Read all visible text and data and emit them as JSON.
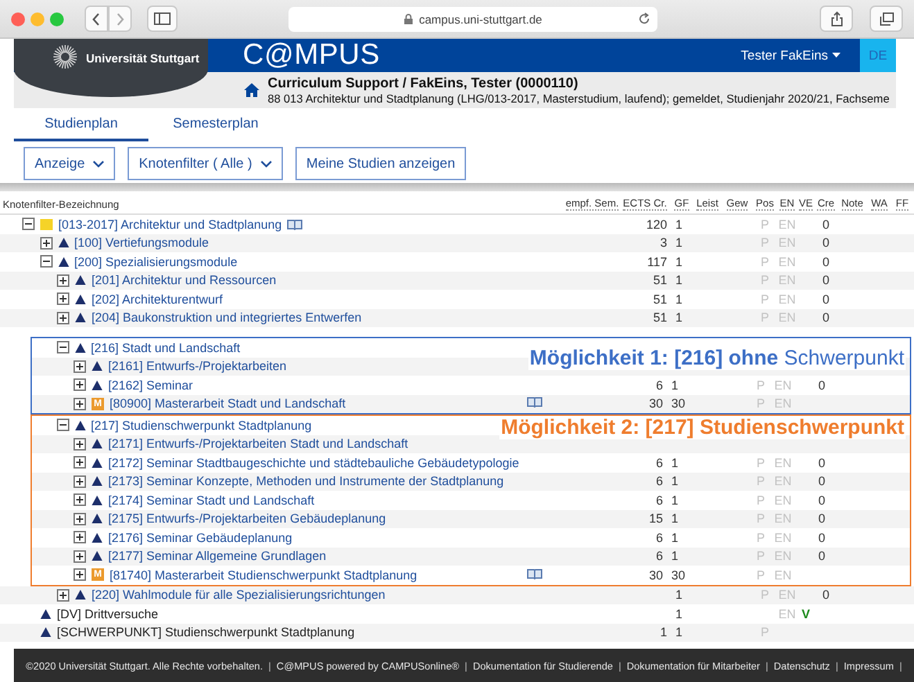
{
  "browser": {
    "url": "campus.uni-stuttgart.de"
  },
  "header": {
    "university": "Universität Stuttgart",
    "brand": "C@MPUS",
    "user": "Tester FakEins",
    "language": "DE"
  },
  "context": {
    "title": "Curriculum Support  / FakEins, Tester (0000110)",
    "subtitle": "88 013 Architektur und Stadtplanung (LHG/013-2017, Masterstudium, laufend); gemeldet, Studienjahr 2020/21, Fachseme"
  },
  "tabs": [
    {
      "label": "Studienplan",
      "selected": true
    },
    {
      "label": "Semesterplan",
      "selected": false
    }
  ],
  "toolbar": [
    {
      "label": "Anzeige",
      "dropdown": true
    },
    {
      "label": "Knotenfilter ( Alle )",
      "dropdown": true
    },
    {
      "label": "Meine Studien anzeigen",
      "dropdown": false
    }
  ],
  "table": {
    "tree_column": "Knotenfilter-Bezeichnung",
    "columns": [
      "empf. Sem.",
      "ECTS Cr.",
      "GF",
      "Leist",
      "Gew",
      "Pos",
      "EN",
      "VE",
      "Cre",
      "Note",
      "WA",
      "FF"
    ],
    "rows": [
      {
        "name": "[013-2017] Architektur und Stadtplanung",
        "kind": "folder",
        "link": true,
        "expanded": true,
        "book": true,
        "cells": [
          null,
          "120",
          "1",
          null,
          null,
          "P",
          "EN",
          null,
          "0",
          null,
          null,
          null
        ],
        "children": [
          {
            "name": "[100] Vertiefungsmodule",
            "kind": "module",
            "link": true,
            "expanded": false,
            "cells": [
              null,
              "3",
              "1",
              null,
              null,
              "P",
              "EN",
              null,
              "0",
              null,
              null,
              null
            ]
          },
          {
            "name": "[200] Spezialisierungsmodule",
            "kind": "module",
            "link": true,
            "expanded": true,
            "cells": [
              null,
              "117",
              "1",
              null,
              null,
              "P",
              "EN",
              null,
              "0",
              null,
              null,
              null
            ],
            "children": [
              {
                "name": "[201] Architektur und Ressourcen",
                "kind": "module",
                "link": true,
                "expanded": false,
                "cells": [
                  null,
                  "51",
                  "1",
                  null,
                  null,
                  "P",
                  "EN",
                  null,
                  "0",
                  null,
                  null,
                  null
                ]
              },
              {
                "name": "[202] Architekturentwurf",
                "kind": "module",
                "link": true,
                "expanded": false,
                "cells": [
                  null,
                  "51",
                  "1",
                  null,
                  null,
                  "P",
                  "EN",
                  null,
                  "0",
                  null,
                  null,
                  null
                ]
              },
              {
                "name": "[204] Baukonstruktion und integriertes Entwerfen",
                "kind": "module",
                "link": true,
                "expanded": false,
                "cells": [
                  null,
                  "51",
                  "1",
                  null,
                  null,
                  "P",
                  "EN",
                  null,
                  "0",
                  null,
                  null,
                  null
                ]
              },
              {
                "name": "[216] Stadt und Landschaft",
                "kind": "module",
                "link": true,
                "expanded": true,
                "annotation": {
                  "text": "**Möglichkeit 1: [216] ohne** Schwerpunkt",
                  "color": "#3d6fc6",
                  "bold": false
                },
                "children": [
                  {
                    "name": "[2161] Entwurfs-/Projektarbeiten",
                    "kind": "module",
                    "link": true,
                    "expanded": false
                  },
                  {
                    "name": "[2162] Seminar",
                    "kind": "module",
                    "link": true,
                    "expanded": false,
                    "cells": [
                      null,
                      "6",
                      "1",
                      null,
                      null,
                      "P",
                      "EN",
                      null,
                      "0",
                      null,
                      null,
                      null
                    ]
                  },
                  {
                    "name": "[80900] Masterarbeit Stadt und Landschaft",
                    "kind": "thesis",
                    "badge": "M",
                    "link": true,
                    "expanded": false,
                    "book": true,
                    "cells": [
                      null,
                      "30",
                      "30",
                      null,
                      null,
                      "P",
                      "EN",
                      null,
                      null,
                      null,
                      null,
                      null
                    ]
                  }
                ]
              },
              {
                "name": "[217] Studienschwerpunkt Stadtplanung",
                "kind": "module",
                "link": true,
                "expanded": true,
                "annotation": {
                  "text": "Möglichkeit 2: [217] Studienschwerpunkt",
                  "color": "#ef7d2e",
                  "bold": true
                },
                "children": [
                  {
                    "name": "[2171] Entwurfs-/Projektarbeiten Stadt und Landschaft",
                    "kind": "module",
                    "link": true,
                    "expanded": false
                  },
                  {
                    "name": "[2172] Seminar Stadtbaugeschichte und städtebauliche Gebäudetypologie",
                    "kind": "module",
                    "link": true,
                    "expanded": false,
                    "cells": [
                      null,
                      "6",
                      "1",
                      null,
                      null,
                      "P",
                      "EN",
                      null,
                      "0",
                      null,
                      null,
                      null
                    ]
                  },
                  {
                    "name": "[2173] Seminar Konzepte, Methoden und Instrumente der Stadtplanung",
                    "kind": "module",
                    "link": true,
                    "expanded": false,
                    "cells": [
                      null,
                      "6",
                      "1",
                      null,
                      null,
                      "P",
                      "EN",
                      null,
                      "0",
                      null,
                      null,
                      null
                    ]
                  },
                  {
                    "name": "[2174] Seminar Stadt und Landschaft",
                    "kind": "module",
                    "link": true,
                    "expanded": false,
                    "cells": [
                      null,
                      "6",
                      "1",
                      null,
                      null,
                      "P",
                      "EN",
                      null,
                      "0",
                      null,
                      null,
                      null
                    ]
                  },
                  {
                    "name": "[2175] Entwurfs-/Projektarbeiten Gebäudeplanung",
                    "kind": "module",
                    "link": true,
                    "expanded": false,
                    "cells": [
                      null,
                      "15",
                      "1",
                      null,
                      null,
                      "P",
                      "EN",
                      null,
                      "0",
                      null,
                      null,
                      null
                    ]
                  },
                  {
                    "name": "[2176] Seminar Gebäudeplanung",
                    "kind": "module",
                    "link": true,
                    "expanded": false,
                    "cells": [
                      null,
                      "6",
                      "1",
                      null,
                      null,
                      "P",
                      "EN",
                      null,
                      "0",
                      null,
                      null,
                      null
                    ]
                  },
                  {
                    "name": "[2177] Seminar Allgemeine Grundlagen",
                    "kind": "module",
                    "link": true,
                    "expanded": false,
                    "cells": [
                      null,
                      "6",
                      "1",
                      null,
                      null,
                      "P",
                      "EN",
                      null,
                      "0",
                      null,
                      null,
                      null
                    ]
                  },
                  {
                    "name": "[81740] Masterarbeit Studienschwerpunkt Stadtplanung",
                    "kind": "thesis",
                    "badge": "M",
                    "link": true,
                    "expanded": false,
                    "book": true,
                    "cells": [
                      null,
                      "30",
                      "30",
                      null,
                      null,
                      "P",
                      "EN",
                      null,
                      null,
                      null,
                      null,
                      null
                    ]
                  }
                ]
              },
              {
                "name": "[220] Wahlmodule für alle Spezialisierungsrichtungen",
                "kind": "module",
                "link": true,
                "expanded": false,
                "cells": [
                  null,
                  null,
                  "1",
                  null,
                  null,
                  "P",
                  "EN",
                  null,
                  "0",
                  null,
                  null,
                  null
                ]
              }
            ]
          }
        ]
      },
      {
        "name": "[DV] Drittversuche",
        "kind": "result",
        "link": false,
        "cells": [
          null,
          null,
          "1",
          null,
          null,
          null,
          "EN",
          "V",
          null,
          null,
          null,
          null
        ]
      },
      {
        "name": "[SCHWERPUNKT] Studienschwerpunkt Stadtplanung",
        "kind": "result",
        "link": false,
        "cells": [
          null,
          "1",
          "1",
          null,
          null,
          "P",
          null,
          null,
          null,
          null,
          null,
          null
        ]
      }
    ]
  },
  "footer": {
    "separator": "|",
    "items": [
      "©2020 Universität Stuttgart. Alle Rechte vorbehalten.",
      "C@MPUS powered by CAMPUSonline®",
      "Dokumentation für Studierende",
      "Dokumentation für Mitarbeiter",
      "Datenschutz",
      "Impressum"
    ]
  }
}
